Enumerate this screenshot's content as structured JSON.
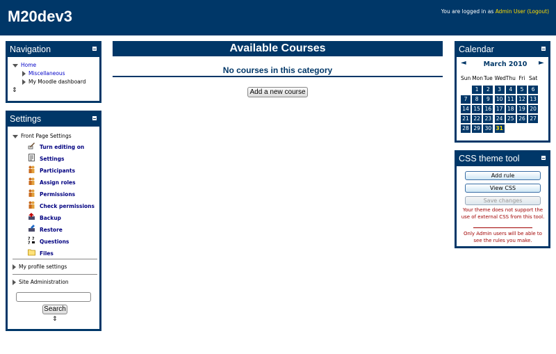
{
  "header": {
    "site_title": "M20dev3",
    "login_prefix": "You are logged in as ",
    "user_name": "Admin User",
    "logout_label": "(Logout)"
  },
  "navigation": {
    "title": "Navigation",
    "home": "Home",
    "miscellaneous": "Miscellaneous",
    "dashboard": "My Moodle dashboard"
  },
  "settings": {
    "title": "Settings",
    "front_page_settings": "Front Page Settings",
    "items": [
      {
        "label": "Turn editing on",
        "icon": "edit-icon"
      },
      {
        "label": "Settings",
        "icon": "settings-icon"
      },
      {
        "label": "Participants",
        "icon": "participants-icon"
      },
      {
        "label": "Assign roles",
        "icon": "roles-icon"
      },
      {
        "label": "Permissions",
        "icon": "permissions-icon"
      },
      {
        "label": "Check permissions",
        "icon": "check-permissions-icon"
      },
      {
        "label": "Backup",
        "icon": "backup-icon"
      },
      {
        "label": "Restore",
        "icon": "restore-icon"
      },
      {
        "label": "Questions",
        "icon": "questions-icon"
      },
      {
        "label": "Files",
        "icon": "folder-icon"
      }
    ],
    "my_profile_settings": "My profile settings",
    "site_administration": "Site Administration",
    "search_button": "Search",
    "search_value": ""
  },
  "main": {
    "title": "Available Courses",
    "no_courses": "No courses in this category",
    "add_course_button": "Add a new course"
  },
  "calendar": {
    "title": "Calendar",
    "month": "March 2010",
    "prev": "◄",
    "next": "►",
    "weekdays": [
      "Sun",
      "Mon",
      "Tue",
      "Wed",
      "Thu",
      "Fri",
      "Sat"
    ],
    "days": [
      "1",
      "2",
      "3",
      "4",
      "5",
      "6",
      "7",
      "8",
      "9",
      "10",
      "11",
      "12",
      "13",
      "14",
      "15",
      "16",
      "17",
      "18",
      "19",
      "20",
      "21",
      "22",
      "23",
      "24",
      "25",
      "26",
      "27",
      "28",
      "29",
      "30",
      "31"
    ],
    "today": "31"
  },
  "css_tool": {
    "title": "CSS theme tool",
    "add_rule": "Add rule",
    "view_css": "View CSS",
    "save_changes": "Save changes",
    "msg1": "Your theme does not support the use of external CSS from this tool.",
    "msg2": "Only Admin users will be able to see the rules you make."
  },
  "colors": {
    "brand": "#003768",
    "highlight": "#ffde00",
    "warning": "#a00000"
  }
}
